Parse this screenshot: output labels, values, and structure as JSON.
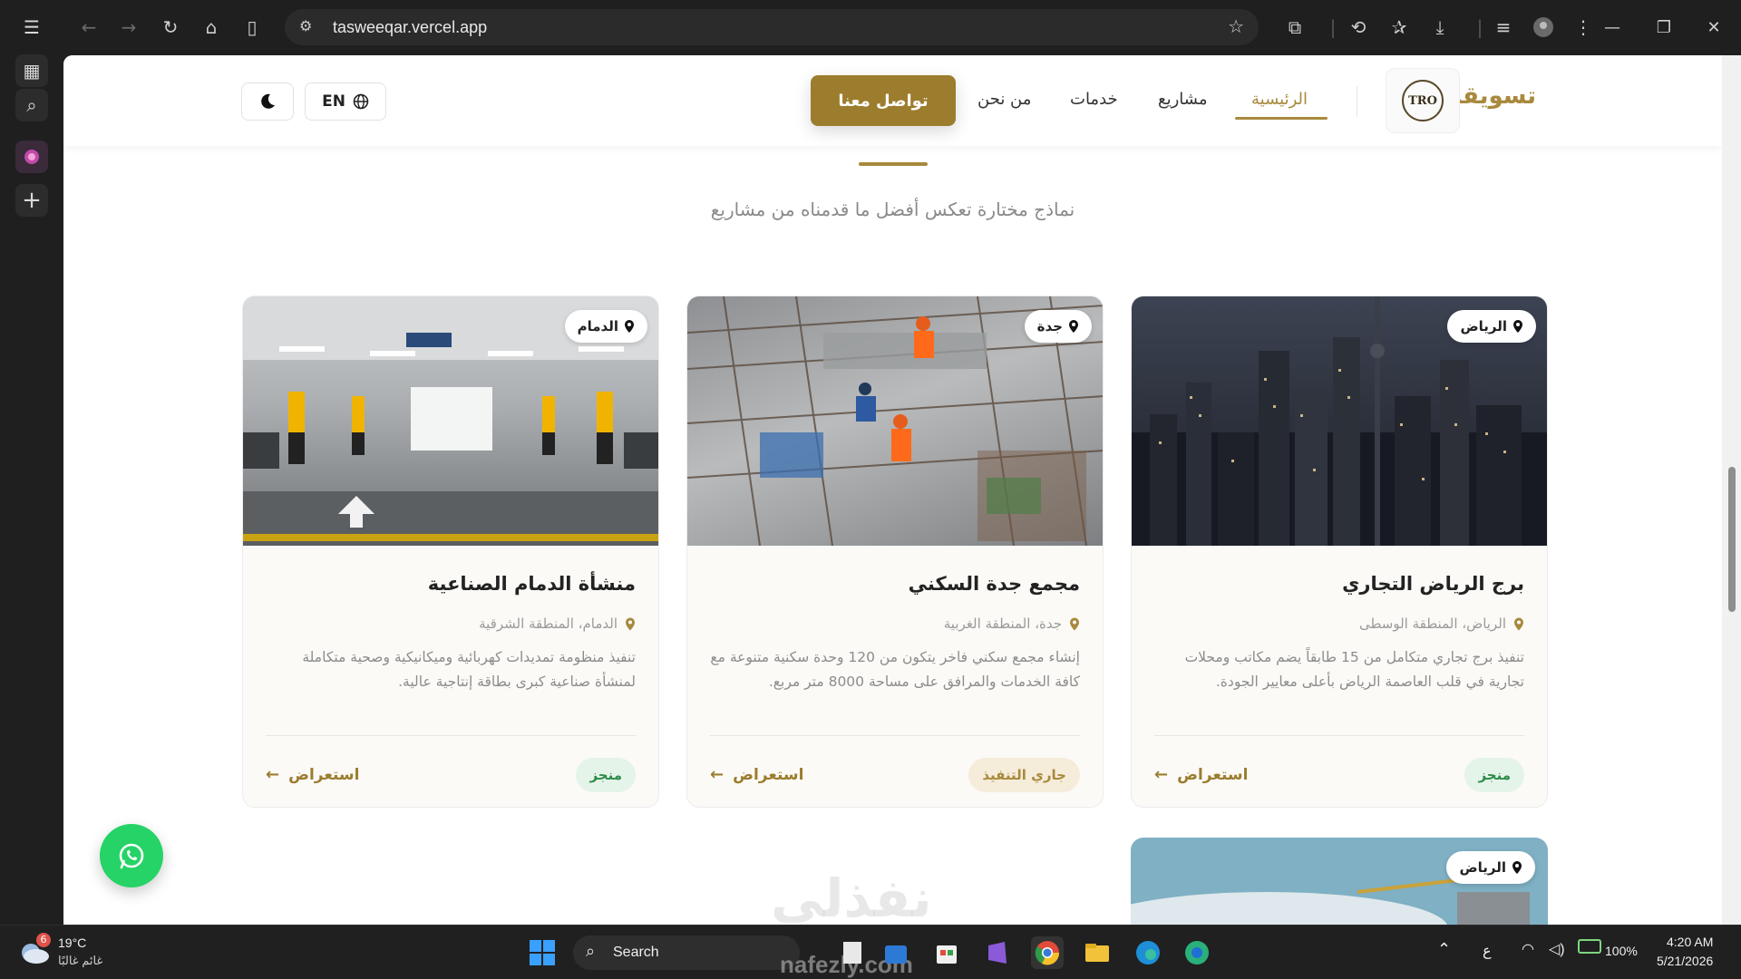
{
  "browser": {
    "url": "tasweeqar.vercel.app"
  },
  "header": {
    "brand": "تسويقار",
    "logo_text": "TRO",
    "nav": {
      "home": "الرئيسية",
      "projects": "مشاريع",
      "services": "خدمات",
      "about": "من نحن"
    },
    "cta": "تواصل معنا",
    "lang": "EN"
  },
  "section": {
    "subtitle": "نماذج مختارة تعكس أفضل ما قدمناه من مشاريع"
  },
  "projects": [
    {
      "city": "الرياض",
      "title": "برج الرياض التجاري",
      "region": "الرياض، المنطقة الوسطى",
      "desc": "تنفيذ برج تجاري متكامل من 15 طابقاً يضم مكاتب ومحلات تجارية في قلب العاصمة الرياض بأعلى معايير الجودة.",
      "status": "منجز",
      "view": "استعراض"
    },
    {
      "city": "جدة",
      "title": "مجمع جدة السكني",
      "region": "جدة، المنطقة الغربية",
      "desc": "إنشاء مجمع سكني فاخر يتكون من 120 وحدة سكنية متنوعة مع كافة الخدمات والمرافق على مساحة 8000 متر مربع.",
      "status": "جاري التنفيذ",
      "view": "استعراض"
    },
    {
      "city": "الدمام",
      "title": "منشأة الدمام الصناعية",
      "region": "الدمام، المنطقة الشرقية",
      "desc": "تنفيذ منظومة تمديدات كهربائية وميكانيكية وصحية متكاملة لمنشأة صناعية كبرى بطاقة إنتاجية عالية.",
      "status": "منجز",
      "view": "استعراض"
    },
    {
      "city": "الرياض"
    }
  ],
  "watermark": "نفذلي",
  "taskbar": {
    "weather_temp": "19°C",
    "weather_desc": "غائم غالبًا",
    "weather_badge": "6",
    "search": "Search",
    "watermark_url": "nafezly.com",
    "lang": "ع",
    "battery": "100%",
    "time": "4:20 AM",
    "date": "5/21/2026"
  },
  "colors": {
    "accent": "#a8893d",
    "cta": "#9c7d2e",
    "done_bg": "#e4f4e8",
    "done_fg": "#2e8b4a",
    "progress_bg": "#f5ecd9",
    "whatsapp": "#25d366"
  }
}
